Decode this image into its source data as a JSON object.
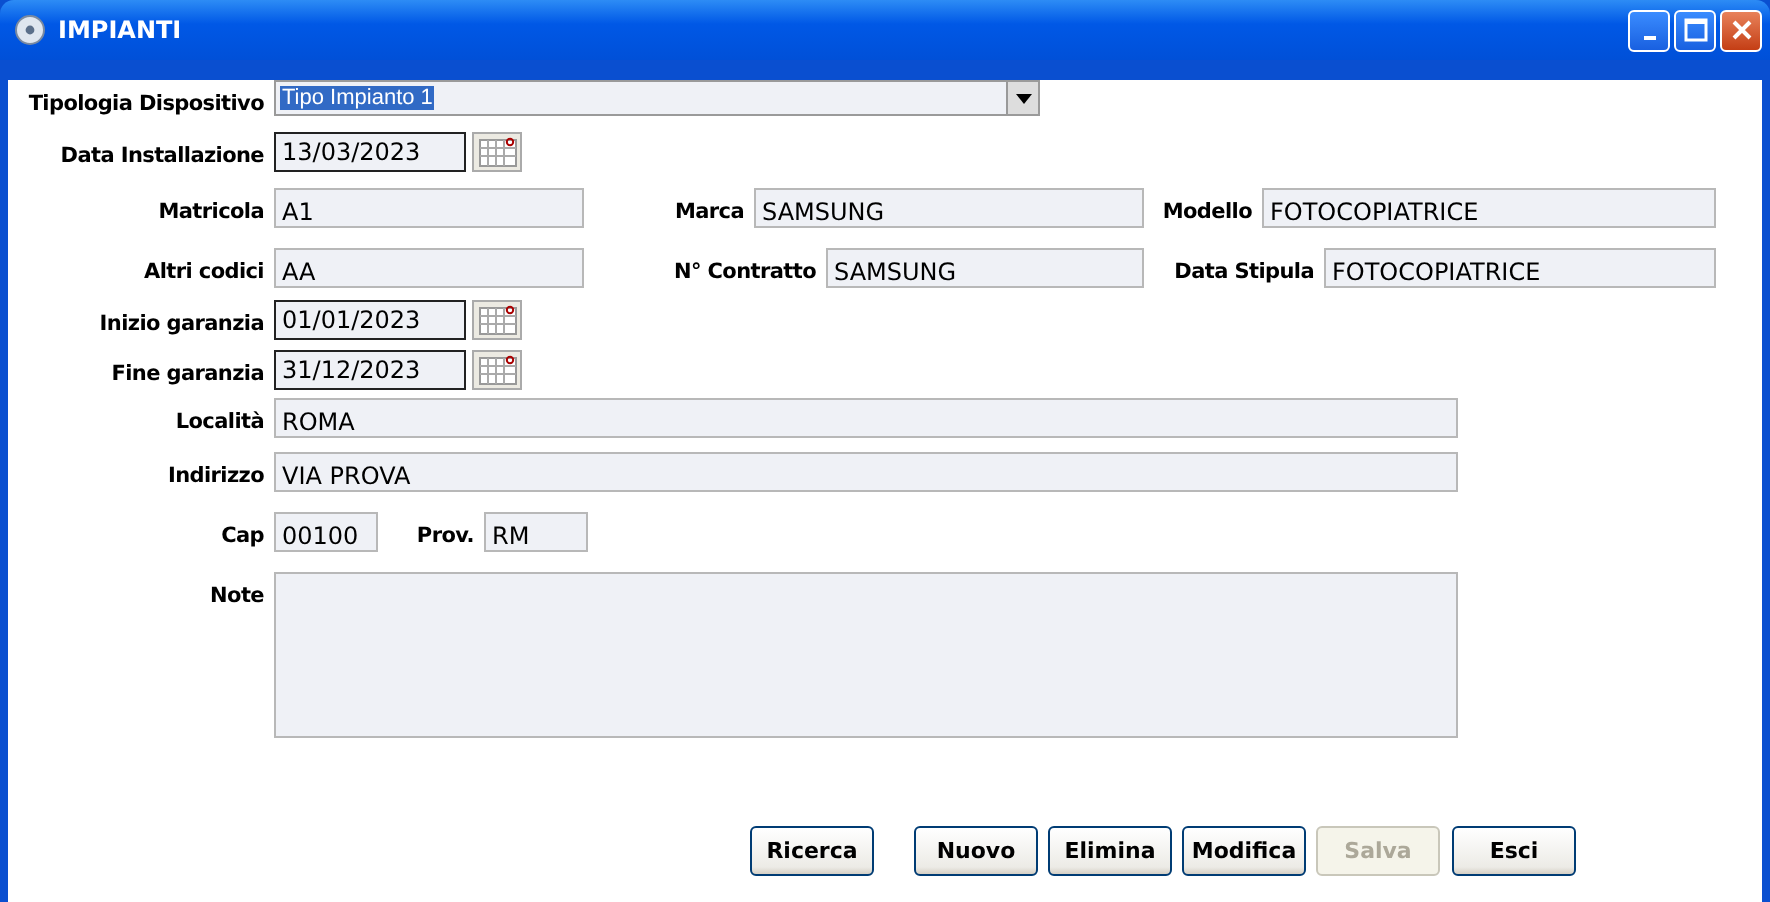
{
  "window": {
    "title": "IMPIANTI"
  },
  "rows": [
    [
      {
        "kind": "combo",
        "label": "Tipologia Dispositivo",
        "value": "Tipo Impianto 1"
      }
    ],
    [
      {
        "kind": "date",
        "label": "Data Installazione",
        "value": "13/03/2023"
      }
    ],
    [
      {
        "kind": "text",
        "label": "Matricola",
        "value": "A1"
      },
      {
        "kind": "text",
        "label": "Marca",
        "value": "SAMSUNG"
      },
      {
        "kind": "text",
        "label": "Modello",
        "value": "FOTOCOPIATRICE"
      }
    ],
    [
      {
        "kind": "text",
        "label": "Altri codici",
        "value": "AA"
      },
      {
        "kind": "text",
        "label": "N° Contratto",
        "value": "SAMSUNG"
      },
      {
        "kind": "text",
        "label": "Data Stipula",
        "value": "FOTOCOPIATRICE"
      }
    ],
    [
      {
        "kind": "date",
        "label": "Inizio garanzia",
        "value": "01/01/2023"
      }
    ],
    [
      {
        "kind": "date",
        "label": "Fine garanzia",
        "value": "31/12/2023"
      }
    ],
    [
      {
        "kind": "text",
        "label": "Località",
        "value": "ROMA"
      }
    ],
    [
      {
        "kind": "text",
        "label": "Indirizzo",
        "value": "VIA PROVA"
      }
    ],
    [
      {
        "kind": "text",
        "label": "Cap",
        "value": "00100"
      },
      {
        "kind": "text",
        "label": "Prov.",
        "value": "RM"
      }
    ],
    [
      {
        "kind": "area",
        "label": "Note"
      }
    ]
  ],
  "buttons": [
    {
      "label": "Ricerca",
      "disabled": false
    },
    {
      "label": "Nuovo",
      "disabled": false
    },
    {
      "label": "Elimina",
      "disabled": false
    },
    {
      "label": "Modifica",
      "disabled": false
    },
    {
      "label": "Salva",
      "disabled": true
    },
    {
      "label": "Esci",
      "disabled": false
    }
  ]
}
